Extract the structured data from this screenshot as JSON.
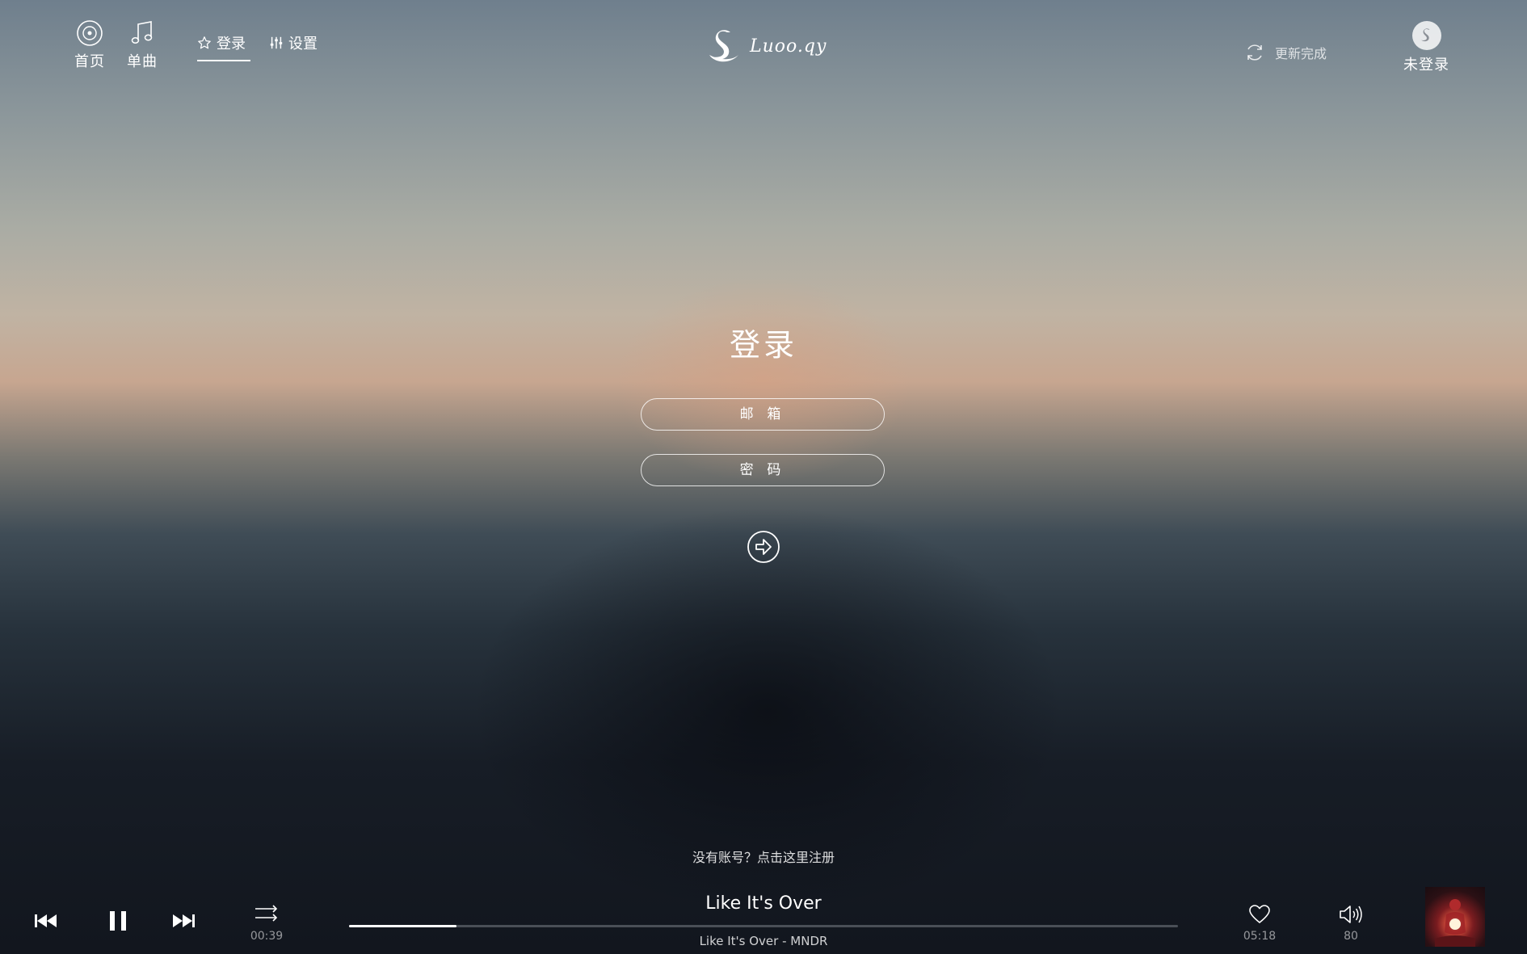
{
  "nav": {
    "home_label": "首页",
    "singles_label": "单曲",
    "tabs": [
      {
        "label": "登录",
        "icon": "star-icon",
        "active": true
      },
      {
        "label": "设置",
        "icon": "sliders-icon",
        "active": false
      }
    ]
  },
  "logo": {
    "text": "Luoo.qy",
    "icon": "swan-icon"
  },
  "status": {
    "update_text": "更新完成",
    "icon": "refresh-icon"
  },
  "user": {
    "label": "未登录",
    "icon": "avatar-icon"
  },
  "login": {
    "title": "登录",
    "email_placeholder": "邮 箱",
    "password_placeholder": "密 码",
    "submit_icon": "arrow-right-circle-icon",
    "register_text": "没有账号？点击这里注册"
  },
  "player": {
    "track_title": "Like It's Over",
    "track_subtitle": "Like It's Over - MNDR",
    "elapsed": "00:39",
    "duration": "05:18",
    "progress": 0.13,
    "volume": "80",
    "colors": {
      "accent": "#ffffff",
      "track_bg": "#4a4f57"
    }
  }
}
